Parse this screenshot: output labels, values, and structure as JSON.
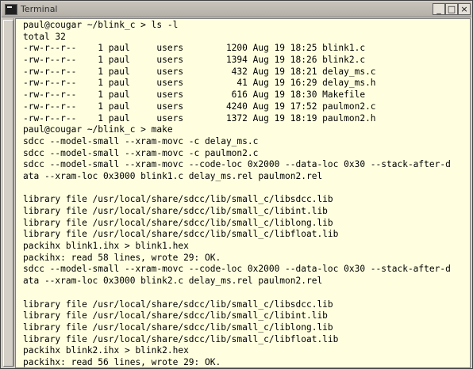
{
  "window": {
    "title": "Terminal",
    "buttons": {
      "minimize": "_",
      "maximize": "□",
      "close": "×"
    }
  },
  "terminal": {
    "lines": [
      "paul@cougar ~/blink_c > ls -l",
      "total 32",
      "-rw-r--r--    1 paul     users        1200 Aug 19 18:25 blink1.c",
      "-rw-r--r--    1 paul     users        1394 Aug 19 18:26 blink2.c",
      "-rw-r--r--    1 paul     users         432 Aug 19 18:21 delay_ms.c",
      "-rw-r--r--    1 paul     users          41 Aug 19 16:29 delay_ms.h",
      "-rw-r--r--    1 paul     users         616 Aug 19 18:30 Makefile",
      "-rw-r--r--    1 paul     users        4240 Aug 19 17:52 paulmon2.c",
      "-rw-r--r--    1 paul     users        1372 Aug 19 18:19 paulmon2.h",
      "paul@cougar ~/blink_c > make",
      "sdcc --model-small --xram-movc -c delay_ms.c",
      "sdcc --model-small --xram-movc -c paulmon2.c",
      "sdcc --model-small --xram-movc --code-loc 0x2000 --data-loc 0x30 --stack-after-d",
      "ata --xram-loc 0x3000 blink1.c delay_ms.rel paulmon2.rel",
      "",
      "library file /usr/local/share/sdcc/lib/small_c/libsdcc.lib",
      "library file /usr/local/share/sdcc/lib/small_c/libint.lib",
      "library file /usr/local/share/sdcc/lib/small_c/liblong.lib",
      "library file /usr/local/share/sdcc/lib/small_c/libfloat.lib",
      "packihx blink1.ihx > blink1.hex",
      "packihx: read 58 lines, wrote 29: OK.",
      "sdcc --model-small --xram-movc --code-loc 0x2000 --data-loc 0x30 --stack-after-d",
      "ata --xram-loc 0x3000 blink2.c delay_ms.rel paulmon2.rel",
      "",
      "library file /usr/local/share/sdcc/lib/small_c/libsdcc.lib",
      "library file /usr/local/share/sdcc/lib/small_c/libint.lib",
      "library file /usr/local/share/sdcc/lib/small_c/liblong.lib",
      "library file /usr/local/share/sdcc/lib/small_c/libfloat.lib",
      "packihx blink2.ihx > blink2.hex",
      "packihx: read 56 lines, wrote 29: OK."
    ],
    "prompt": "paul@cougar ~/blink_c > "
  }
}
